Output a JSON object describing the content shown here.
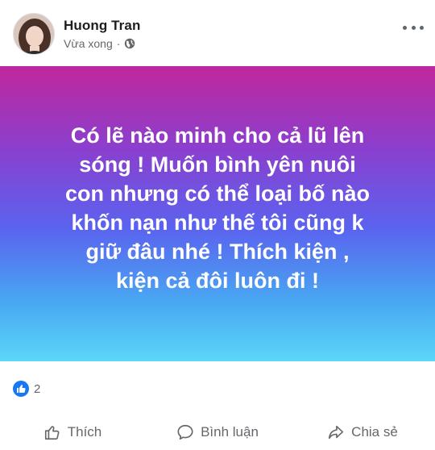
{
  "post": {
    "author": "Huong Tran",
    "timestamp": "Vừa xong",
    "separator": "·",
    "privacy_icon": "globe-icon",
    "more_icon": "more-horizontal-icon",
    "text": "Có lẽ nào minh cho cả lũ lên\nsóng ! Muốn bình yên nuôi\ncon nhưng có thể loại bố nào\nkhốn nạn như thế tôi cũng k\ngiữ đâu nhé ! Thích kiện ,\nkiện cả đôi luôn đi !",
    "background_gradient": [
      "#c0279d",
      "#8b3fce",
      "#5a63ef",
      "#48a8f2",
      "#5cd6f8"
    ]
  },
  "reactions": {
    "icon": "like-reaction-icon",
    "count": "2",
    "color": "#1877f2"
  },
  "actions": [
    {
      "label": "Thích",
      "icon": "thumbs-up-icon"
    },
    {
      "label": "Bình luận",
      "icon": "comment-icon"
    },
    {
      "label": "Chia sẻ",
      "icon": "share-icon"
    }
  ]
}
